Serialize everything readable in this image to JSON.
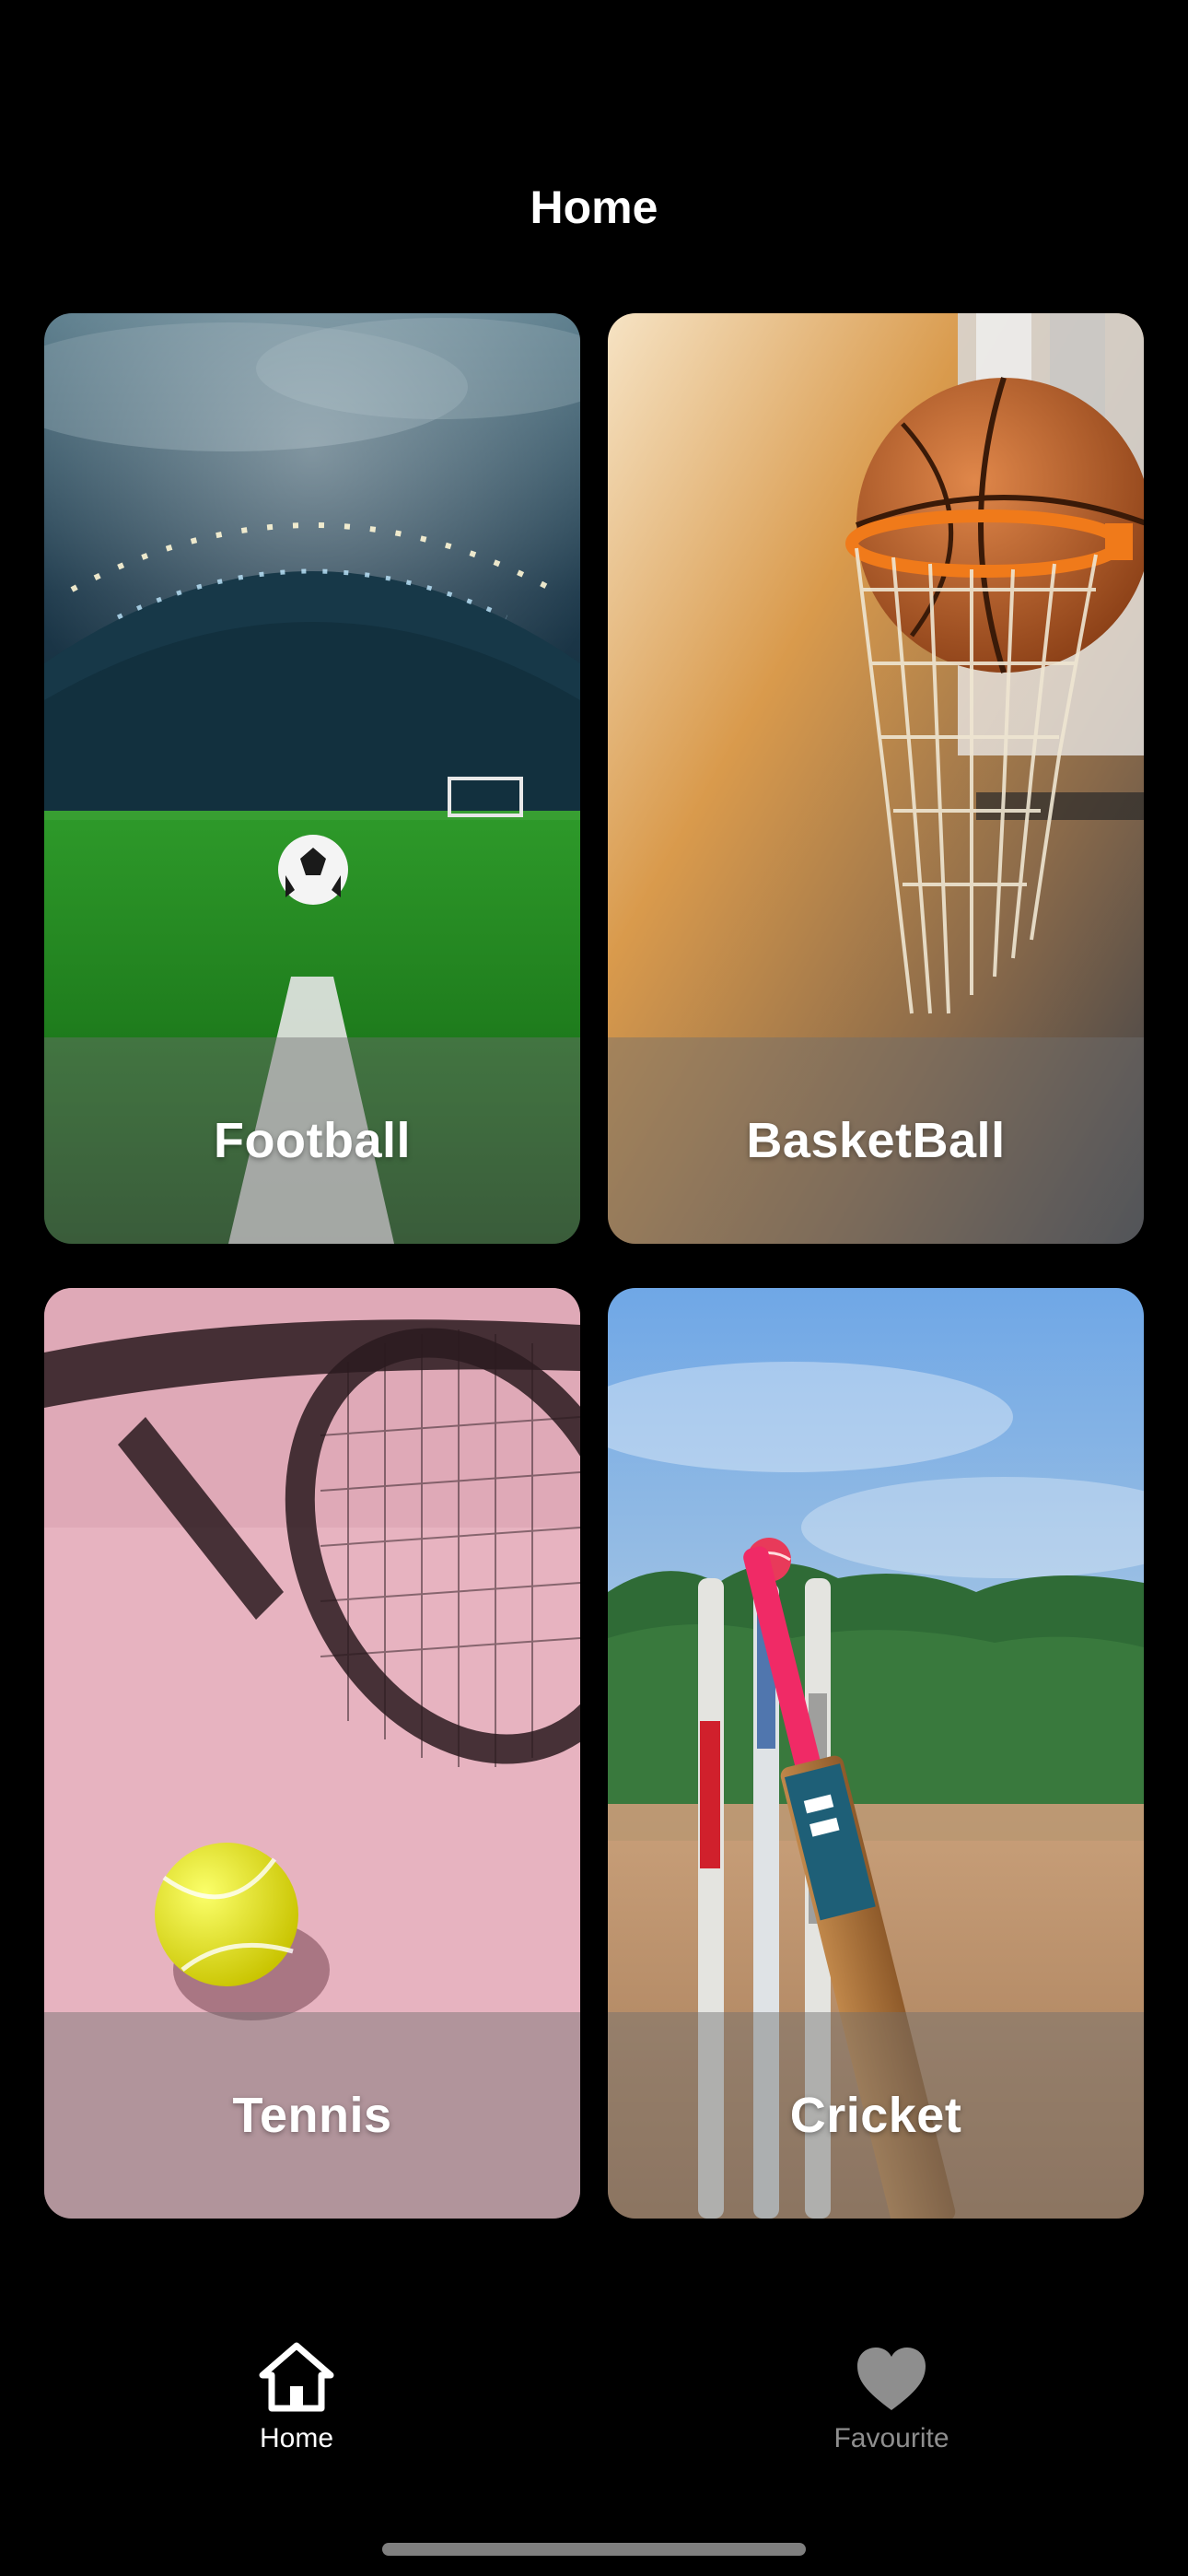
{
  "header": {
    "title": "Home"
  },
  "cards": [
    {
      "label": "Football",
      "image": "football-stadium-image"
    },
    {
      "label": "BasketBall",
      "image": "basketball-hoop-image"
    },
    {
      "label": "Tennis",
      "image": "tennis-racket-ball-image"
    },
    {
      "label": "Cricket",
      "image": "cricket-bat-stumps-image"
    }
  ],
  "tabbar": {
    "items": [
      {
        "label": "Home",
        "icon": "home-icon",
        "active": true
      },
      {
        "label": "Favourite",
        "icon": "heart-icon",
        "active": false
      }
    ]
  },
  "colors": {
    "background": "#000000",
    "active_tab": "#ffffff",
    "inactive_tab": "#8e8e8e"
  }
}
